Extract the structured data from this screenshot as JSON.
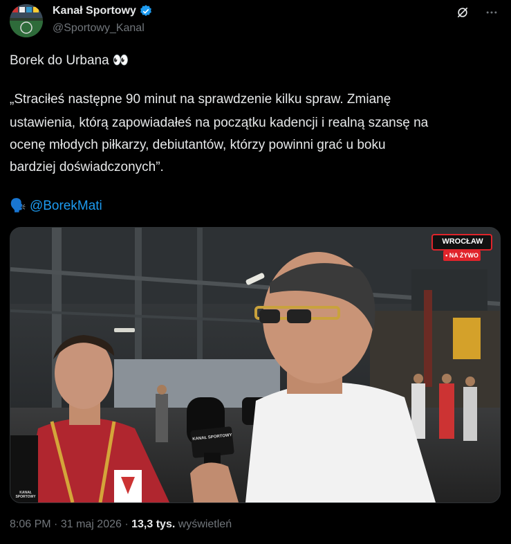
{
  "author": {
    "name": "Kanał Sportowy",
    "handle": "@Sportowy_Kanal"
  },
  "tweet": {
    "line1": "Borek do Urbana 👀",
    "quote_lines": [
      "„Straciłeś następne 90 minut na sprawdzenie kilku spraw. Zmianę",
      "ustawienia, którą zapowiadałeś na początku kadencji i realną szansę na",
      "ocenę młodych piłkarzy, debiutantów, którzy powinni grać u boku",
      "bardziej doświadczonych”."
    ],
    "speaker_emoji": "🗣️",
    "mention": "@BorekMati"
  },
  "media": {
    "badge_city": "WROCŁAW",
    "badge_live": "• NA ŻYWO",
    "mic_label": "KANAŁ SPORTOWY",
    "mic_label2": "KANAŁ SPORTOWY"
  },
  "meta": {
    "time": "8:06 PM",
    "sep1": "·",
    "date": "31 maj 2026",
    "sep2": "·",
    "views_count": "13,3 tys.",
    "views_label": "wyświetleń"
  },
  "colors": {
    "accent": "#1d9bf0",
    "live_red": "#e0242b"
  }
}
